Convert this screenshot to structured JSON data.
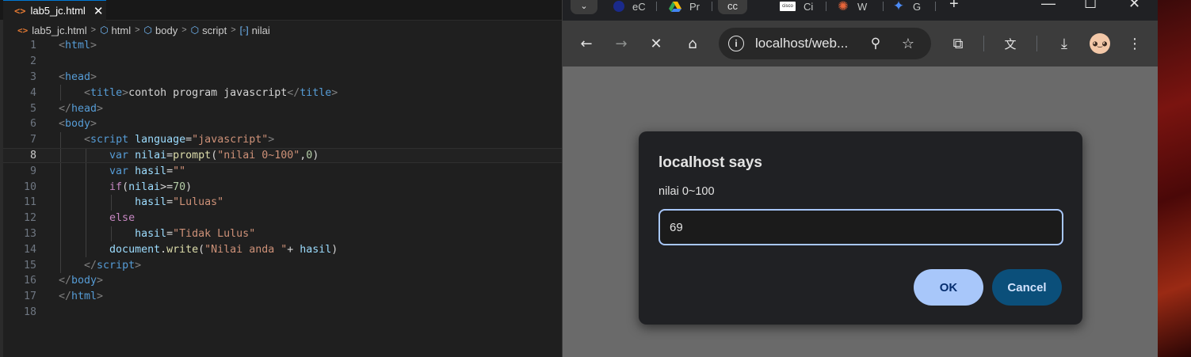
{
  "editor": {
    "tab": {
      "icon": "html-file-icon",
      "label": "lab5_jc.html",
      "close": "✕"
    },
    "breadcrumb": [
      "lab5_jc.html",
      "html",
      "body",
      "script",
      "nilai"
    ],
    "active_line": 8,
    "line_numbers": [
      "1",
      "2",
      "3",
      "4",
      "5",
      "6",
      "7",
      "8",
      "9",
      "10",
      "11",
      "12",
      "13",
      "14",
      "15",
      "16",
      "17",
      "18"
    ],
    "colors": {
      "tag": "#569cd6",
      "string": "#ce9178",
      "attr": "#9cdcfe",
      "number": "#b5cea8",
      "function": "#dcdcaa",
      "control": "#c586c0"
    }
  },
  "browser": {
    "tabs": [
      {
        "label": "eC",
        "favicon": "shield-favicon"
      },
      {
        "label": "Pr",
        "favicon": "drive-favicon"
      },
      {
        "label": "cc",
        "favicon": "",
        "active": true
      },
      {
        "label": "Ci",
        "favicon": "cisco-favicon",
        "favicon_text": "cisco"
      },
      {
        "label": "W",
        "favicon": "starburst-favicon"
      },
      {
        "label": "G",
        "favicon": "gemini-favicon"
      }
    ],
    "new_tab": "+",
    "window_controls": {
      "minimize": "—",
      "maximize": "☐",
      "close": "✕"
    },
    "address": "localhost/web...",
    "toolbar_icons": [
      "back-icon",
      "forward-icon",
      "stop-icon",
      "home-icon",
      "zoom-icon",
      "bookmark-star-icon",
      "extensions-icon",
      "translate-icon",
      "download-icon",
      "profile-avatar",
      "menu-icon"
    ]
  },
  "dialog": {
    "title": "localhost says",
    "message": "nilai 0~100",
    "input_value": "69",
    "ok": "OK",
    "cancel": "Cancel"
  }
}
